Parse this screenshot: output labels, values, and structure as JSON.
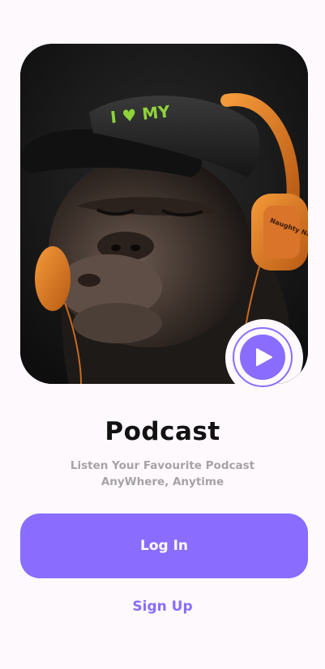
{
  "hero": {
    "image_alt": "Monkey wearing a cap and orange headphones",
    "cap_text": "I ♥ MY",
    "headphone_text": "Naughty Nature"
  },
  "play_button": {
    "icon": "play-icon"
  },
  "title": "Podcast",
  "subtitle_line1": "Listen Your Favourite Podcast",
  "subtitle_line2": "AnyWhere, Anytime",
  "login_label": "Log In",
  "signup_label": "Sign Up",
  "colors": {
    "accent": "#8a6cff",
    "background": "#fdf9fd",
    "title": "#121212",
    "subtitle": "#a6a3a7"
  }
}
